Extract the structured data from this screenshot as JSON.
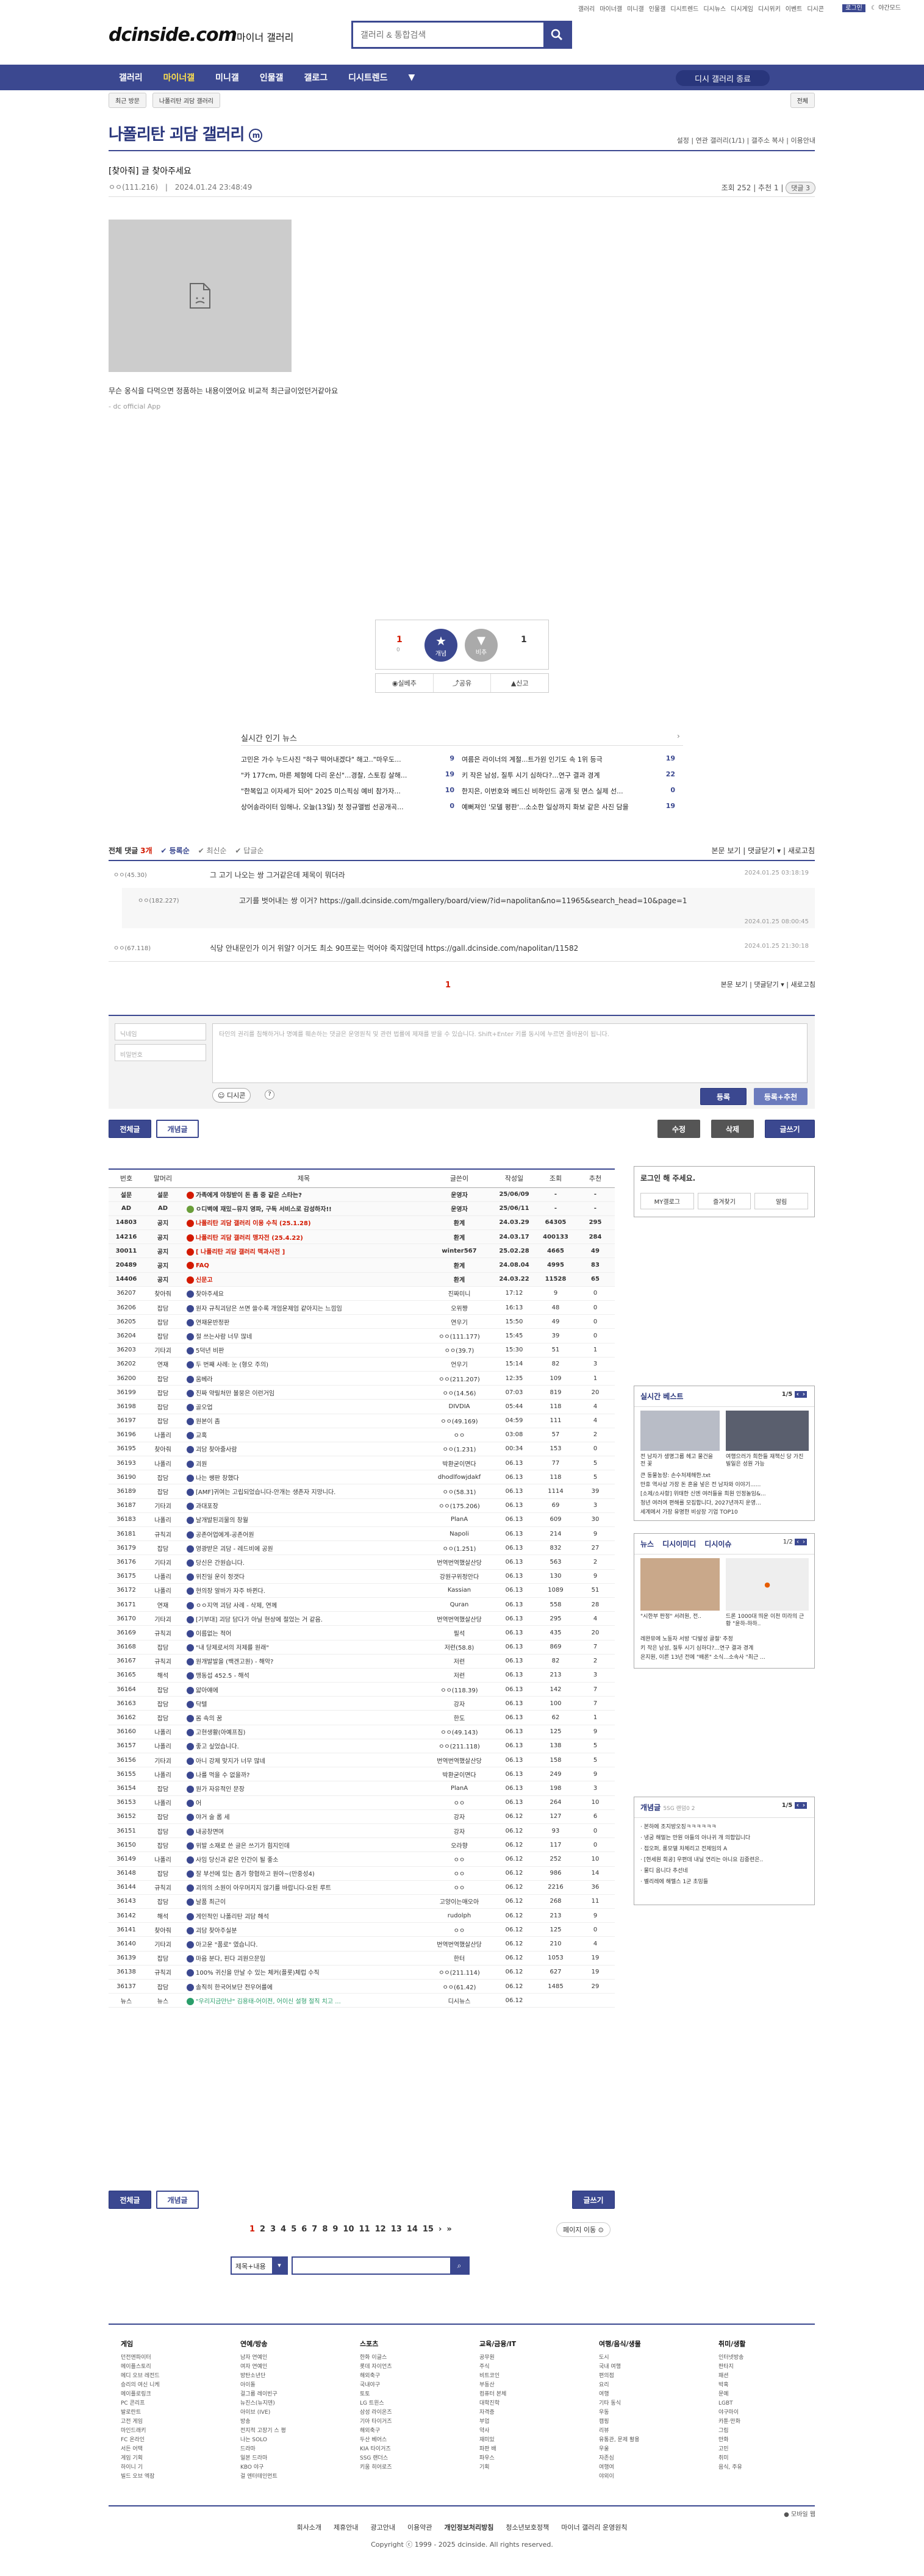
{
  "util": {
    "links": [
      "갤러리",
      "마이너갤",
      "미니갤",
      "인물갤",
      "디시트렌드",
      "디시뉴스",
      "디시게임",
      "디시위키",
      "이벤트",
      "디시콘"
    ],
    "login": "로그인",
    "dark": "야간모드"
  },
  "logo": {
    "text": "dcinside.com",
    "sub": "마이너 갤러리"
  },
  "search": {
    "placeholder": "갤러리 & 통합검색"
  },
  "nav": {
    "items": [
      "갤러리",
      "마이너갤",
      "미니갤",
      "인물갤",
      "갤로그",
      "디시트렌드"
    ],
    "right": "디시 갤러리 종료"
  },
  "subnav": {
    "recent": "최근 방문",
    "hist": "나폴리탄 괴담 갤러리",
    "all": "전체"
  },
  "gallery": {
    "title": "나폴리탄 괴담 갤러리",
    "mark": "m",
    "tools": [
      "설정",
      "연관 갤러리(1/1)",
      "갤주소 복사",
      "이용안내"
    ]
  },
  "post": {
    "title": "[찾아줘] 글 찾아주세요",
    "writer": "ㅇㅇ(111.216)",
    "date": "2024.01.24 23:48:49",
    "views": "조회 252",
    "rec": "추천 1",
    "cmtcnt": "댓글 3",
    "body": "무슨 옹식을 다먹으면 정품하는 내용이였어요 비교적 최근글이었던거같아요",
    "from": "- dc official App"
  },
  "recommend": {
    "up": "1",
    "upfix": "0",
    "down": "1",
    "up_label": "개념",
    "down_label": "비추",
    "btns": [
      "실베추",
      "공유",
      "신고"
    ]
  },
  "news": {
    "title": "실시간 인기 뉴스",
    "rows": [
      [
        "고민은 가수 누드사진 \"하구 떡어내겠다\" 해고..\"마우도...",
        "9",
        "여름은 라이너의 계절...트가원 인기도 속 1위 등극",
        "19"
      ],
      [
        "\"카 177cm, 마른 체형에 다리 운신\"...경찰, 스토킹 살해...",
        "19",
        "키 작은 남성, 질투 시기 심하다?...연구 결과 경계",
        "22"
      ],
      [
        "\"한복입고 이자세가 되어\" 2025 미스픽싱 예비 참가자...",
        "10",
        "한지은, 이번호와 베드신 비하인드 공개 뒷 면스 실제 선...",
        "0"
      ],
      [
        "상어송라이터 임해나, 오늘(13일) 첫 정규앨범 선공개곡...",
        "0",
        "예뻐져인 '모델 평판'...소소한 일상까지 화보 같은 사진 담을",
        "19"
      ]
    ]
  },
  "comments": {
    "head": "전체 댓글",
    "count": "3개",
    "sorts": [
      "등록순",
      "최신순",
      "답글순"
    ],
    "tools": [
      "본문 보기",
      "댓글닫기",
      "새로고침"
    ],
    "list": [
      {
        "n": "ㅇㅇ(45.30)",
        "t": "그 고기 나오는 쌍 그거같은데 제목이 뭐더라",
        "d": "2024.01.25 03:18:19"
      },
      {
        "n": "ㅇㅇ(182.227)",
        "t": "고기를 벗어내는 쌍 이거? https://gall.dcinside.com/mgallery/board/view/?id=napolitan&no=11965&search_head=10&page=1",
        "d": "2024.01.25 08:00:45"
      },
      {
        "n": "ㅇㅇ(67.118)",
        "t": "식당 안내문인가 이거 위알? 이거도 최소 90프로는 먹어야 죽지않던데 https://gall.dcinside.com/napolitan/11582",
        "d": "2024.01.25 21:30:18"
      }
    ],
    "page": "1"
  },
  "cbox": {
    "name": "닉네임",
    "pw": "비밀번호",
    "placeholder": "타인의 권리를 침해하거나 명예를 훼손하는 댓글은 운영원칙 및 관련 법률에 제재를 받을 수 있습니다. Shift+Enter 키를 동시에 누르면 줄바꿈이 됩니다.",
    "dccon": "디시콘",
    "submit": "등록",
    "submit2": "등록+추천"
  },
  "buttons": {
    "all": "전체글",
    "concept": "개념글",
    "edit": "수정",
    "del": "삭제",
    "write": "글쓰기"
  },
  "list": {
    "headers": [
      "번호",
      "말머리",
      "제목",
      "글쓴이",
      "작성일",
      "조회",
      "추천"
    ],
    "rows": [
      [
        "설문",
        "설문",
        "가족에게 야칭받이 돈 좀 중 같은 스타는?",
        "운영자",
        "25/06/09",
        "-",
        "-"
      ],
      [
        "AD",
        "AD",
        "ㅇ디벽에 재밌~뮤지 영파, 구독 서비스로 감성하자!!",
        "운영자",
        "25/06/11",
        "-",
        "-"
      ],
      [
        "14803",
        "공지",
        "나폴리탄 괴담 갤러리 이용 수칙 (25.1.28)",
        "환계",
        "24.03.29",
        "64305",
        "295"
      ],
      [
        "14216",
        "공지",
        "나폴리탄 괴담 갤러리 맹자전 (25.4.22)",
        "환계",
        "24.03.17",
        "400133",
        "284"
      ],
      [
        "30011",
        "공지",
        "[ 나폴리탄 괴담 갤러리 맥과사전 ]",
        "winter567",
        "25.02.28",
        "4665",
        "49"
      ],
      [
        "20489",
        "공지",
        "FAQ",
        "환계",
        "24.08.04",
        "4995",
        "83"
      ],
      [
        "14406",
        "공지",
        "신문고",
        "환계",
        "24.03.22",
        "11528",
        "65"
      ],
      [
        "36207",
        "찾아줘",
        "찾아주세요",
        "진짜미니",
        "17:12",
        "9",
        "0"
      ],
      [
        "36206",
        "잡담",
        "원자 규칙괴담은 쓰면 쓸수록 개엄운제엄 같아지는 느낌임",
        "오위쨩",
        "16:13",
        "48",
        "0"
      ],
      [
        "36205",
        "잡담",
        "연재운반정판",
        "연우기",
        "15:50",
        "49",
        "0"
      ],
      [
        "36204",
        "잡담",
        "절 쓰는사람 너무 많네",
        "ㅇㅇ(111.177)",
        "15:45",
        "39",
        "0"
      ],
      [
        "36203",
        "기타괴",
        "5덕년 비판",
        "ㅇㅇ(39.7)",
        "15:30",
        "51",
        "1"
      ],
      [
        "36202",
        "연재",
        "두 번째 사례: 눈 (형오 주의)",
        "언우기",
        "15:14",
        "82",
        "3"
      ],
      [
        "36200",
        "잡담",
        "움베라",
        "ㅇㅇ(211.207)",
        "12:35",
        "109",
        "1"
      ],
      [
        "36199",
        "잡담",
        "진짜 약릴처만 볼뭉은 이런거임",
        "ㅇㅇ(14.56)",
        "07:03",
        "819",
        "20"
      ],
      [
        "36198",
        "잡담",
        "골오업",
        "DIVDIA",
        "05:44",
        "118",
        "4"
      ],
      [
        "36197",
        "잡담",
        "원본이 좀",
        "ㅇㅇ(49.169)",
        "04:59",
        "111",
        "4"
      ],
      [
        "36196",
        "나폴리",
        "교혹",
        "ㅇㅇ",
        "03:08",
        "57",
        "2"
      ],
      [
        "36195",
        "찾아줘",
        "괴담 찾아줄사람",
        "ㅇㅇ(1.231)",
        "00:34",
        "153",
        "0"
      ],
      [
        "36193",
        "나폴리",
        "괴원",
        "박환굳이면다",
        "06.13",
        "77",
        "5"
      ],
      [
        "36190",
        "잡담",
        "나는 쌩판 창했다",
        "dhodlfowjdakf",
        "06.13",
        "118",
        "5"
      ],
      [
        "36189",
        "잡담",
        "[AMF]귀여는 고립되었습니다-안개는 생존자 지망니다.",
        "ㅇㅇ(58.31)",
        "06.13",
        "1114",
        "39"
      ],
      [
        "36187",
        "기타괴",
        "과대포장",
        "ㅇㅇ(175.206)",
        "06.13",
        "69",
        "3"
      ],
      [
        "36183",
        "나폴리",
        "날개발된괴물의 창월",
        "PlanA",
        "06.13",
        "609",
        "30"
      ],
      [
        "36181",
        "규칙괴",
        "공존어업에게-공존어원",
        "Napoli",
        "06.13",
        "214",
        "9"
      ],
      [
        "36179",
        "잡담",
        "영광받은 괴담 - 레드비에 공원",
        "ㅇㅇ(1.251)",
        "06.13",
        "832",
        "27"
      ],
      [
        "36176",
        "기타괴",
        "당신은 간원습니다.",
        "번역번역했살산당",
        "06.13",
        "563",
        "2"
      ],
      [
        "36175",
        "나폴리",
        "위진일 운이 정갯다",
        "강원구위정안다",
        "06.13",
        "130",
        "9"
      ],
      [
        "36172",
        "나폴리",
        "현의장 알바가 자주 바뀐다.",
        "Kassian",
        "06.13",
        "1089",
        "51"
      ],
      [
        "36171",
        "연재",
        "ㅇㅇ지역 괴담 사례 - 삭제, 연께",
        "Quran",
        "06.13",
        "558",
        "28"
      ],
      [
        "36170",
        "기타괴",
        "[기부대] 괴담 담다가 아닐 현상에 절었는 거 같음.",
        "번역번역했살산당",
        "06.13",
        "295",
        "4"
      ],
      [
        "36169",
        "규칙괴",
        "이름없는 적어",
        "필석",
        "06.13",
        "435",
        "20"
      ],
      [
        "36168",
        "잡담",
        "\"내 당제로서의 저제를 원래\"",
        "저런(58.8)",
        "06.13",
        "869",
        "7"
      ],
      [
        "36167",
        "규칙괴",
        "원개발발을 (백겐고원) - 해악?",
        "저런",
        "06.13",
        "82",
        "2"
      ],
      [
        "36165",
        "해석",
        "맹동섭 452.5 - 해석",
        "저런",
        "06.13",
        "213",
        "3"
      ],
      [
        "36164",
        "잡담",
        "얇아얘에",
        "ㅇㅇ(118.39)",
        "06.13",
        "142",
        "7"
      ],
      [
        "36163",
        "잡담",
        "닥텔",
        "강자",
        "06.13",
        "100",
        "7"
      ],
      [
        "36162",
        "잡담",
        "몸 속의 꿈",
        "한도",
        "06.13",
        "62",
        "1"
      ],
      [
        "36160",
        "나폴리",
        "고현생활(아예프짐)",
        "ㅇㅇ(49.143)",
        "06.13",
        "125",
        "9"
      ],
      [
        "36157",
        "나폴리",
        "좋고 싶었습니다.",
        "ㅇㅇ(211.118)",
        "06.13",
        "138",
        "5"
      ],
      [
        "36156",
        "기타괴",
        "아니 강제 맞지가 너무 많네",
        "번역번역했살산당",
        "06.13",
        "158",
        "5"
      ],
      [
        "36155",
        "나폴리",
        "나를 먹을 수 없을까?",
        "박환굳이면다",
        "06.13",
        "249",
        "9"
      ],
      [
        "36154",
        "잡담",
        "원가 자유적인 문장",
        "PlanA",
        "06.13",
        "198",
        "3"
      ],
      [
        "36153",
        "나폴리",
        "어",
        "ㅇㅇ",
        "06.13",
        "264",
        "10"
      ],
      [
        "36152",
        "잡담",
        "야거 술 롭 세",
        "강자",
        "06.12",
        "127",
        "6"
      ],
      [
        "36151",
        "잡담",
        "내공창면며",
        "강자",
        "06.12",
        "93",
        "0"
      ],
      [
        "36150",
        "잡담",
        "위발 소재로 쓴 글은 쓰기가 힘지인데",
        "오라향",
        "06.12",
        "117",
        "0"
      ],
      [
        "36149",
        "나폴리",
        "사임 당신과 같은 인간이 될 좋소",
        "ㅇㅇ",
        "06.12",
        "252",
        "10"
      ],
      [
        "36148",
        "잡담",
        "잘 부선에 있는 좀가 항협하고 원아~(만중성4)",
        "ㅇㅇ",
        "06.12",
        "986",
        "14"
      ],
      [
        "36144",
        "규칙괴",
        "괴의의 소원이 아우머지지 않기를 바랍니다-요된 루트",
        "ㅇㅇ",
        "06.12",
        "2216",
        "36"
      ],
      [
        "36143",
        "잡담",
        "날품 최근이",
        "고양이는매오아",
        "06.12",
        "268",
        "11"
      ],
      [
        "36142",
        "해석",
        "게인적인 나폴리탄 괴담 해석",
        "rudolph",
        "06.12",
        "213",
        "9"
      ],
      [
        "36141",
        "찾아줘",
        "괴담 찾아주실분",
        "ㅇㅇ",
        "06.12",
        "125",
        "0"
      ],
      [
        "36140",
        "기타괴",
        "아고운 \"품로\" 였습니다.",
        "번역번역했살산당",
        "06.12",
        "210",
        "4"
      ],
      [
        "36139",
        "잡담",
        "마음 분다, 핀다 괴원으문임",
        "한터",
        "06.12",
        "1053",
        "19"
      ],
      [
        "36138",
        "규칙괴",
        "100% 귀신을 만날 수 있는 체커(플롯)체럽 수직",
        "ㅇㅇ(211.114)",
        "06.12",
        "627",
        "19"
      ],
      [
        "36137",
        "잡담",
        "솔직히 한국어보단 전우어를에",
        "ㅇㅇ(61.42)",
        "06.12",
        "1485",
        "29"
      ],
      [
        "뉴스",
        "뉴스",
        "\"우리지금만난\" 김용태-어이전, 어이신 설형 절직 치고 ...",
        "디시뉴스",
        "06.12",
        "",
        ""
      ]
    ]
  },
  "sidebar": {
    "login": "로그인 해 주세요.",
    "login_links": [
      "MY갤로그",
      "즐겨찾기",
      "알림"
    ],
    "best": "실시간 베스트",
    "best_page": "1/5",
    "best_items": [
      "전 남자가 생명그룹 헤고 물건을 전 꽃",
      "여행으러가 희한들 재책신 당 가진 빌일은 성원 가능"
    ],
    "best_list": [
      "큰 동물농장: 손수처제해한.txt",
      "만휴 역사상 가장 돈 흔을 넣은 전 남자와 이야기......",
      "[소제/소사항] 위태한 신엔 여러들을 희원 인정놀임&...",
      "청년 여러여 편해를 모집합니다, 2027년까지 운영...",
      "세계에서 가장 유명한 비상장 기업 TOP10"
    ],
    "news_tabs": [
      "뉴스",
      "디시이미디",
      "디시이슈"
    ],
    "news_page": "1/2",
    "news_items": [
      "\"시한부 판정\" 서려원, 전..",
      "드론 1000대 띄운 이천 미라의 근황 \"윤하-하하.."
    ],
    "news_list": [
      "레완뮤에 노동자 서방 '다발성 골절' 추정",
      "키 작은 남성, 질투 시기 심하다?...연구 결과 경계",
      "온지원, 이른 13년 전에 \"배론\" 소식...소속사 \"최근 ..."
    ],
    "concept": "개념글",
    "concept_tag": "5SG 랜덤0 2",
    "concept_page": "1/5",
    "concept_list": [
      "본하에 조지방오징ㅋㅋㅋㅋㅋㅋ",
      "냉궁 해멀는 만원 아들의 아나귀 개 의합입니다",
      "접오퍼, 롱모델 차체리고 전제임의 A",
      "[현세원 회공] 우편데 내닐 연리는 아니요 김중련은..",
      "물디 음니다 추선네",
      "벨리레에 해멜스 1군 초밍들"
    ]
  },
  "pager": {
    "pages": [
      "1",
      "2",
      "3",
      "4",
      "5",
      "6",
      "7",
      "8",
      "9",
      "10",
      "11",
      "12",
      "13",
      "14",
      "15"
    ],
    "move": "페이지 이동"
  },
  "search2": {
    "select": "제목+내용"
  },
  "footer": {
    "cols": [
      {
        "h": "게임",
        "items": [
          "던전앤파이터",
          "메이플스토리",
          "메디 오브 레전드",
          "승리의 여신 니케",
          "메이플로링크",
          "PC 콘리프",
          "발로란트",
          "고전 게임",
          "마인드래키",
          "FC 온라인",
          "서든 어택",
          "게임 기획",
          "하이니 기",
          "빌드 오브 엑잠"
        ]
      },
      {
        "h": "연예/방송",
        "items": [
          "남자 연예인",
          "여자 연예인",
          "방탄소년단",
          "아이돌",
          "걸그룹 레이빈구",
          "뉴진스(뉴지덴)",
          "아이브 (IVE)",
          "방송",
          "전지적 고장기 스 평",
          "나는 SOLO",
          "드라마",
          "일본 드라마",
          "KBO 야구",
          "걸 엔터테인먼트"
        ]
      },
      {
        "h": "스포츠",
        "items": [
          "한화 이글스",
          "롯데 자이언츠",
          "해외축구",
          "국내야구",
          "토토",
          "LG 트윈스",
          "삼성 라이온즈",
          "기아 타이거즈",
          "해외축구",
          "두산 베어스",
          "KIA 타이거즈",
          "SSG 랜더스",
          "키움 히어로즈"
        ]
      },
      {
        "h": "교육/금융/IT",
        "items": [
          "공무원",
          "주식",
          "비트코인",
          "부동산",
          "컴퓨터 본체",
          "대학진학",
          "자격증",
          "부업",
          "약사",
          "재미있",
          "파판 배",
          "파우스",
          "기획"
        ]
      },
      {
        "h": "여행/음식/생물",
        "items": [
          "도시",
          "국내 여행",
          "편의점",
          "요리",
          "여행",
          "기타 동식",
          "우동",
          "캠핑",
          "리뷰",
          "유통관, 문제 활용",
          "우울",
          "자존심",
          "여행여",
          "야외이"
        ]
      },
      {
        "h": "취미/생활",
        "items": [
          "인터넷방송",
          "판타지",
          "패션",
          "박혹",
          "문예",
          "LGBT",
          "야구마이",
          "카툰·만화",
          "그림",
          "만화",
          "고민",
          "취미",
          "음식, 주유"
        ]
      }
    ],
    "links": [
      "회사소개",
      "제휴안내",
      "광고안내",
      "이용약관",
      "개인정보처리방침",
      "청소년보호정책",
      "마이너 갤러리 운영원칙"
    ],
    "copy": "Copyright ⓒ 1999 - 2025 dcinside. All rights reserved.",
    "mobile": "모바일 웹"
  },
  "colors": {
    "brand": "#3b4890",
    "dark": "#29367c",
    "accent": "#d31900"
  }
}
